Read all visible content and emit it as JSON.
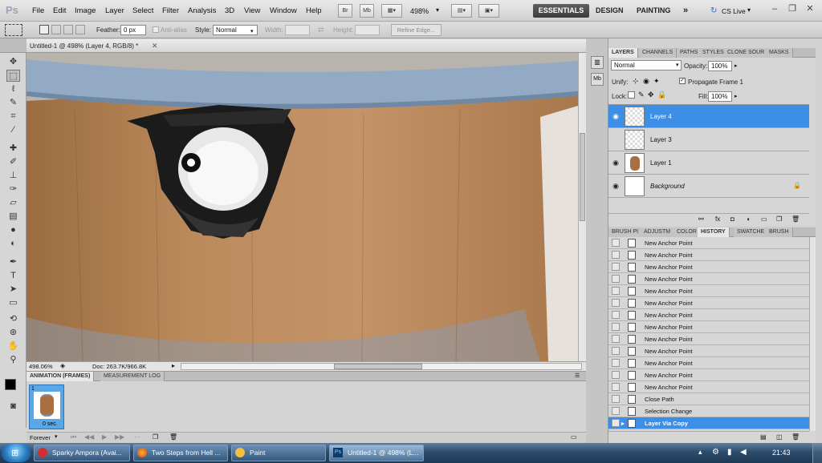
{
  "app": {
    "logo": "Ps"
  },
  "menu": [
    "File",
    "Edit",
    "Image",
    "Layer",
    "Select",
    "Filter",
    "Analysis",
    "3D",
    "View",
    "Window",
    "Help"
  ],
  "toolbar": {
    "br_label": "Br",
    "mb_label": "Mb",
    "zoom_value": "498%"
  },
  "workspaces": {
    "active": "ESSENTIALS",
    "items": [
      "DESIGN",
      "PAINTING"
    ],
    "more": "»",
    "cslive": "CS Live"
  },
  "options": {
    "feather_label": "Feather:",
    "feather_value": "0 px",
    "antialias_label": "Anti-alias",
    "style_label": "Style:",
    "style_value": "Normal",
    "width_label": "Width:",
    "height_label": "Height:",
    "refine_edge": "Refine Edge..."
  },
  "document": {
    "tab_title": "Untitled-1 @ 498% (Layer 4, RGB/8) *",
    "zoom": "498.06%",
    "doc_info": "Doc: 263.7K/966.8K"
  },
  "animation": {
    "tabs": [
      "ANIMATION (FRAMES)",
      "MEASUREMENT LOG"
    ],
    "frame_number": "1",
    "frame_delay": "0 sec.",
    "loop": "Forever"
  },
  "layers_panel": {
    "tabs": [
      "LAYERS",
      "CHANNELS",
      "PATHS",
      "STYLES",
      "CLONE SOUR",
      "MASKS"
    ],
    "blend_mode": "Normal",
    "opacity_label": "Opacity:",
    "opacity_value": "100%",
    "unify_label": "Unify:",
    "propagate_label": "Propagate Frame 1",
    "lock_label": "Lock:",
    "fill_label": "Fill:",
    "fill_value": "100%",
    "layers": [
      {
        "name": "Layer 4",
        "visible": true,
        "selected": true
      },
      {
        "name": "Layer 3",
        "visible": false,
        "selected": false
      },
      {
        "name": "Layer 1",
        "visible": true,
        "selected": false
      },
      {
        "name": "Background",
        "visible": true,
        "selected": false
      }
    ]
  },
  "history_panel": {
    "tabs": [
      "BRUSH PI",
      "ADJUSTM",
      "COLOR",
      "HISTORY",
      "SWATCHE",
      "BRUSH"
    ],
    "items": [
      "New Anchor Point",
      "New Anchor Point",
      "New Anchor Point",
      "New Anchor Point",
      "New Anchor Point",
      "New Anchor Point",
      "New Anchor Point",
      "New Anchor Point",
      "New Anchor Point",
      "New Anchor Point",
      "New Anchor Point",
      "New Anchor Point",
      "New Anchor Point",
      "Close Path",
      "Selection Change",
      "Layer Via Copy"
    ],
    "selected_index": 15
  },
  "taskbar": {
    "tasks": [
      "Sparky Ampora (Avai...",
      "Two Steps from Hell ...",
      "Paint",
      "Untitled-1 @ 498% (L..."
    ],
    "active_index": 3,
    "clock": "21:43"
  }
}
